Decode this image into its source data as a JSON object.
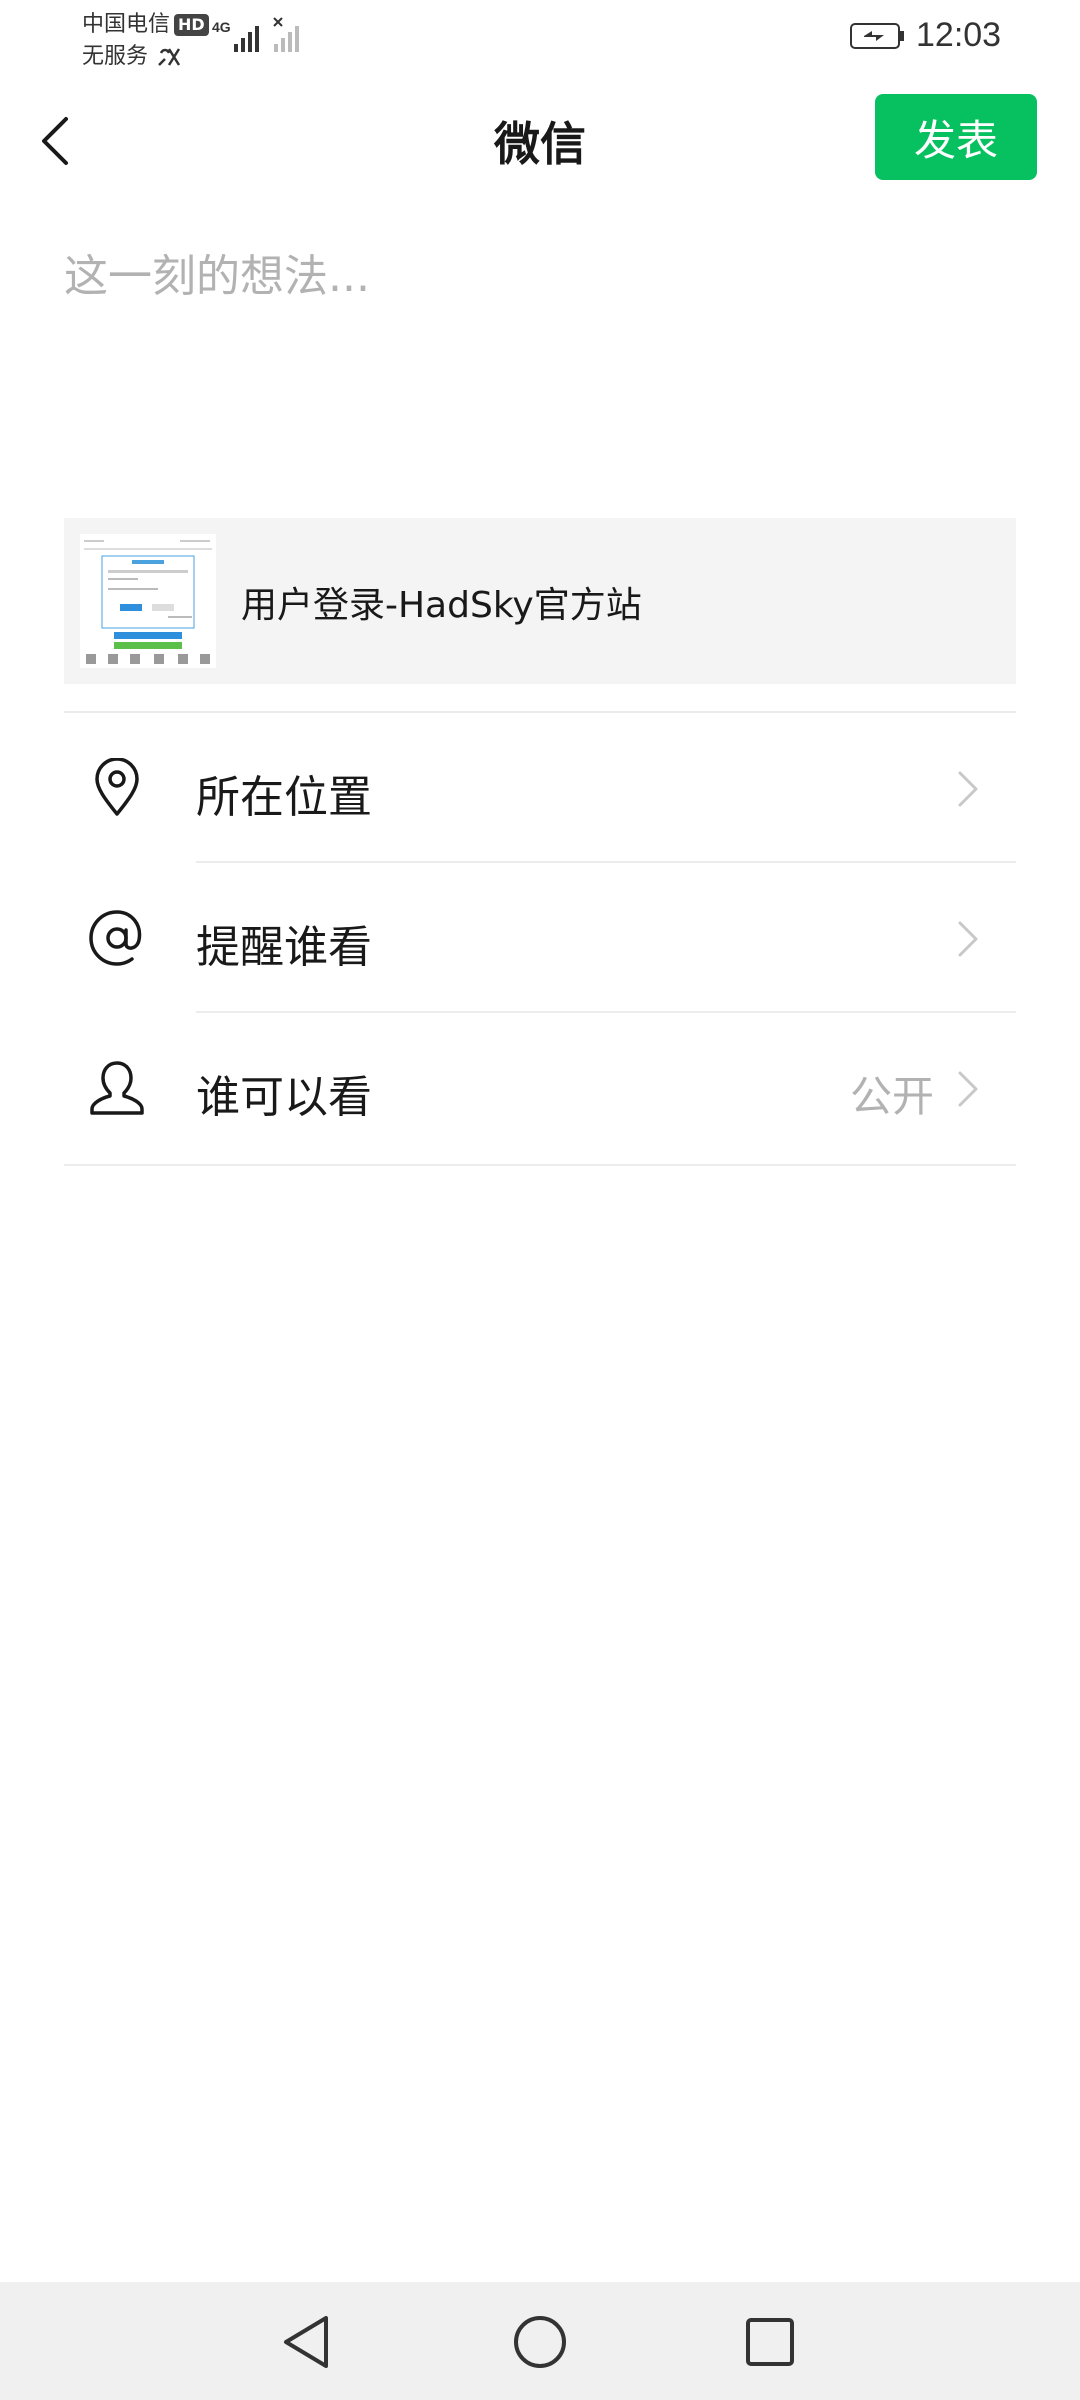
{
  "status_bar": {
    "carrier_line1": "中国电信",
    "hd_badge": "HD",
    "carrier_line2": "无服务",
    "network_type": "4G",
    "time": "12:03"
  },
  "nav": {
    "title": "微信",
    "publish_label": "发表"
  },
  "composer": {
    "placeholder": "这一刻的想法..."
  },
  "link_card": {
    "title": "用户登录-HadSky官方站"
  },
  "options": [
    {
      "label": "所在位置",
      "value": "",
      "icon": "location-pin-icon"
    },
    {
      "label": "提醒谁看",
      "value": "",
      "icon": "at-sign-icon"
    },
    {
      "label": "谁可以看",
      "value": "公开",
      "icon": "person-icon"
    }
  ],
  "colors": {
    "accent": "#07c160",
    "placeholder": "#b2b2b2",
    "card_bg": "#f4f4f4"
  }
}
